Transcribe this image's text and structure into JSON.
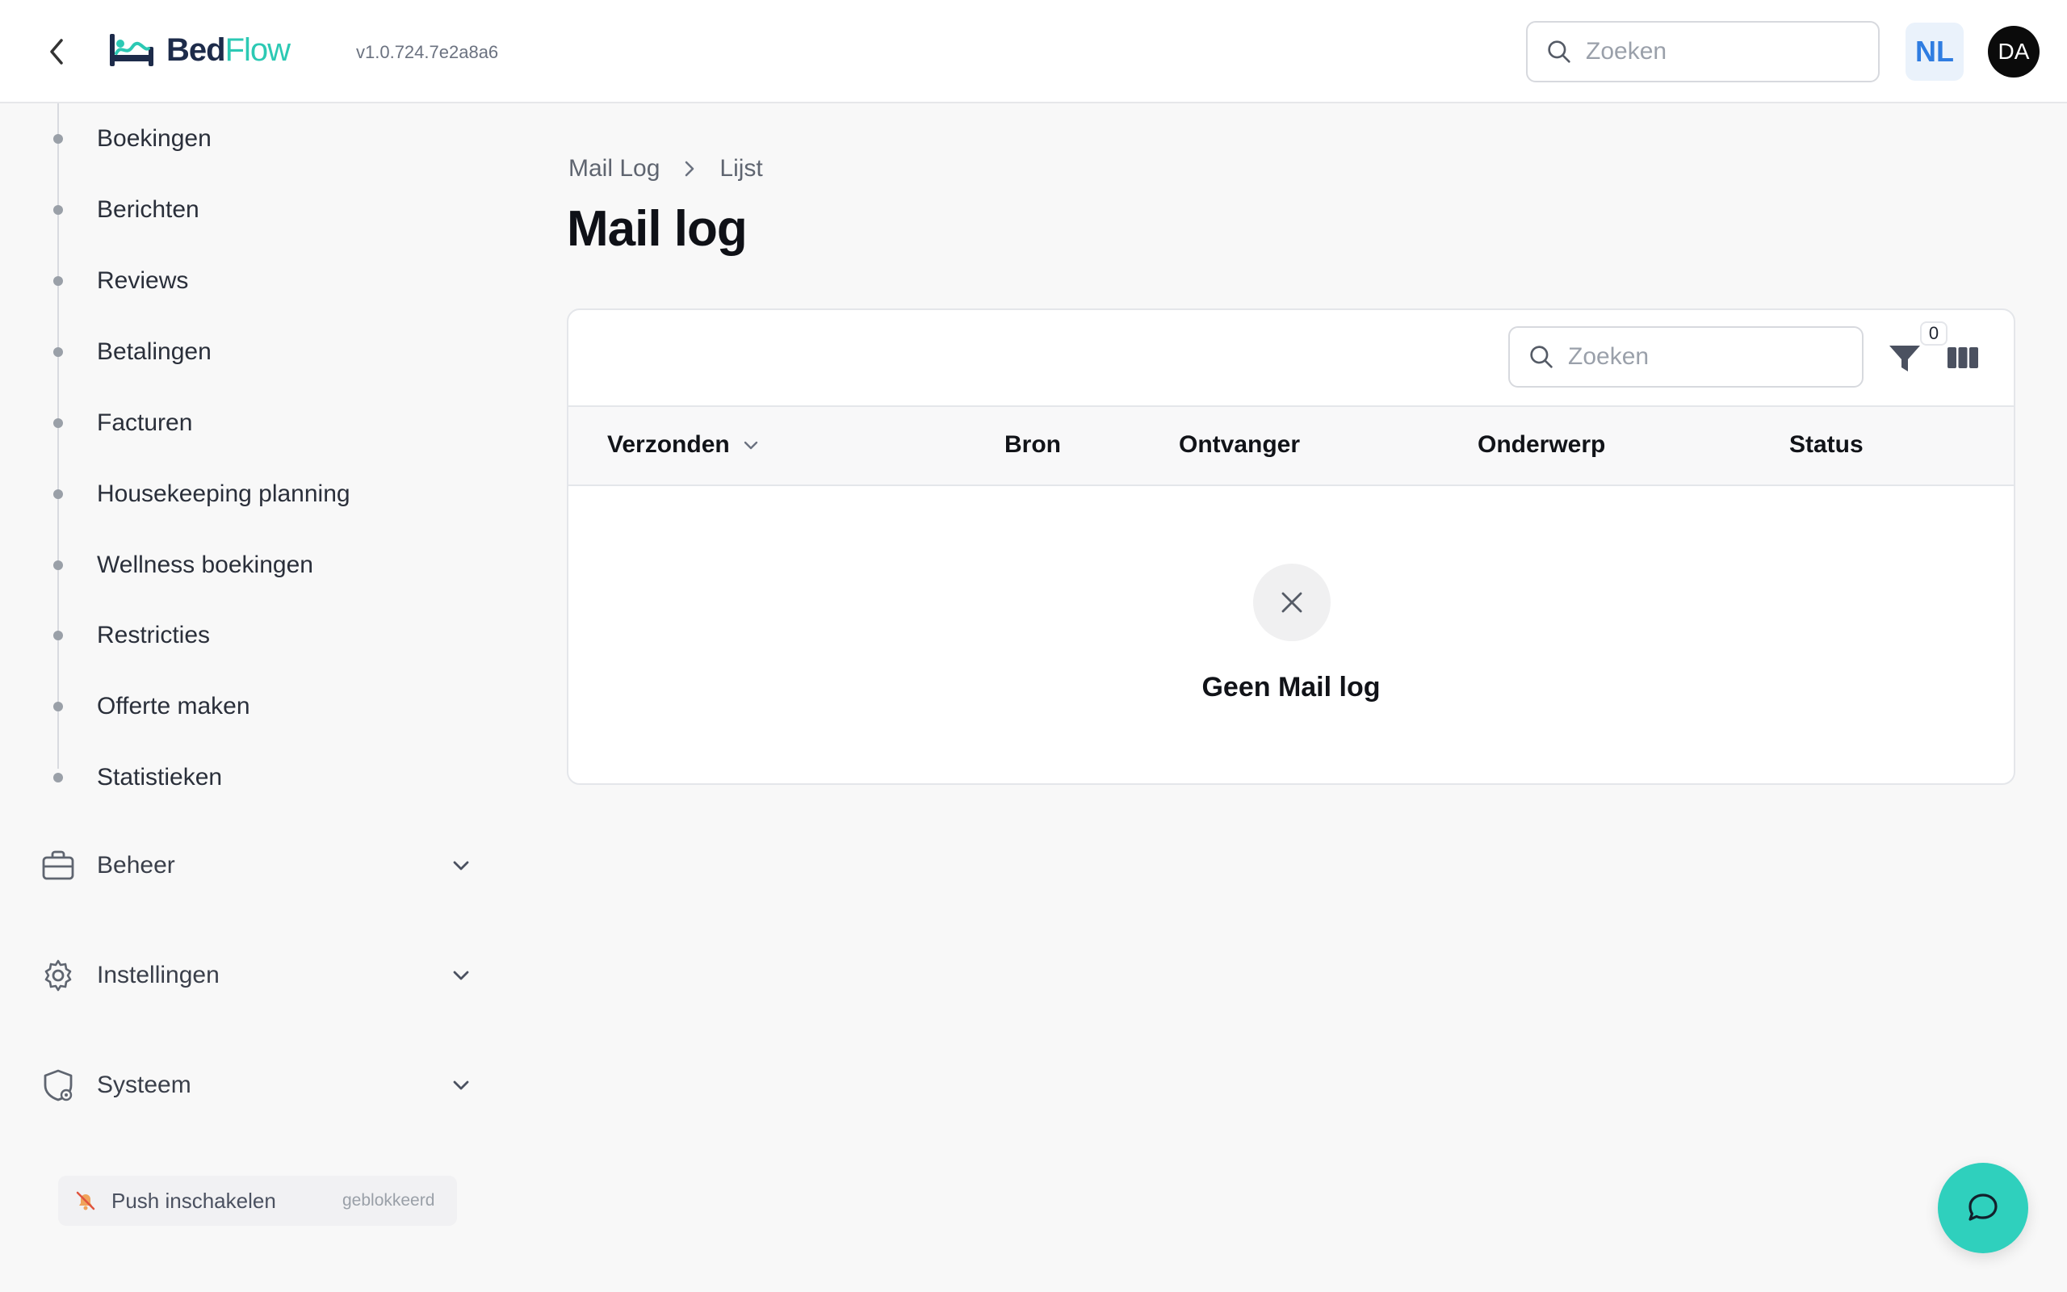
{
  "app": {
    "logo_part1": "Bed",
    "logo_part2": "Flow",
    "version": "v1.0.724.7e2a8a6"
  },
  "header": {
    "search_placeholder": "Zoeken",
    "language": "NL",
    "avatar_initials": "DA"
  },
  "sidebar": {
    "items": [
      {
        "label": "Boekingen"
      },
      {
        "label": "Berichten"
      },
      {
        "label": "Reviews"
      },
      {
        "label": "Betalingen"
      },
      {
        "label": "Facturen"
      },
      {
        "label": "Housekeeping planning"
      },
      {
        "label": "Wellness boekingen"
      },
      {
        "label": "Restricties"
      },
      {
        "label": "Offerte maken"
      },
      {
        "label": "Statistieken"
      }
    ],
    "groups": [
      {
        "label": "Beheer",
        "icon": "briefcase-icon"
      },
      {
        "label": "Instellingen",
        "icon": "gear-icon"
      },
      {
        "label": "Systeem",
        "icon": "shield-gear-icon"
      }
    ],
    "push": {
      "label": "Push inschakelen",
      "status": "geblokkeerd"
    }
  },
  "breadcrumb": {
    "items": [
      "Mail Log",
      "Lijst"
    ]
  },
  "page": {
    "title": "Mail log"
  },
  "table": {
    "search_placeholder": "Zoeken",
    "filter_count": "0",
    "columns": [
      "Verzonden",
      "Bron",
      "Ontvanger",
      "Onderwerp",
      "Status"
    ],
    "empty_text": "Geen Mail log"
  },
  "colors": {
    "accent": "#2cc9b4",
    "brand_dark": "#1d2b4a",
    "lang_bg": "#eaf2fb",
    "lang_text": "#2f7de1"
  }
}
